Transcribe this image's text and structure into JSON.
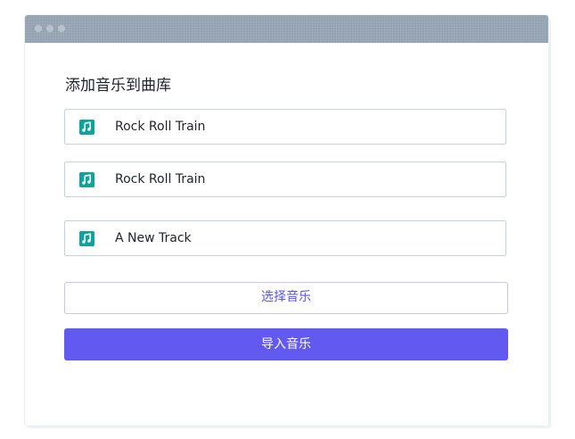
{
  "window": {
    "controls": [
      "window-dot",
      "window-dot",
      "window-dot"
    ]
  },
  "main": {
    "heading": "添加音乐到曲库",
    "tracks": [
      {
        "title": "Rock Roll Train",
        "icon": "music-note-icon"
      },
      {
        "title": "Rock Roll Train",
        "icon": "music-note-icon"
      },
      {
        "title": "A New Track",
        "icon": "music-note-icon"
      }
    ],
    "select_button": "选择音乐",
    "import_button": "导入音乐"
  },
  "colors": {
    "titlebar": "#94a3b1",
    "icon_accent": "#0fa39b",
    "primary": "#6259f0",
    "primary_text": "#5b55e6"
  }
}
